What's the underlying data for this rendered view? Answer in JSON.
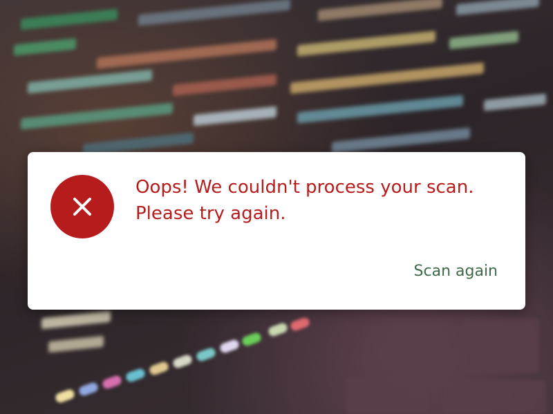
{
  "dialog": {
    "icon": "close-icon",
    "message": "Oops! We couldn't process your scan. Please try again.",
    "action_label": "Scan again"
  },
  "colors": {
    "error": "#b71c1c",
    "action": "#3d6b47",
    "dialog_background": "#ffffff"
  }
}
